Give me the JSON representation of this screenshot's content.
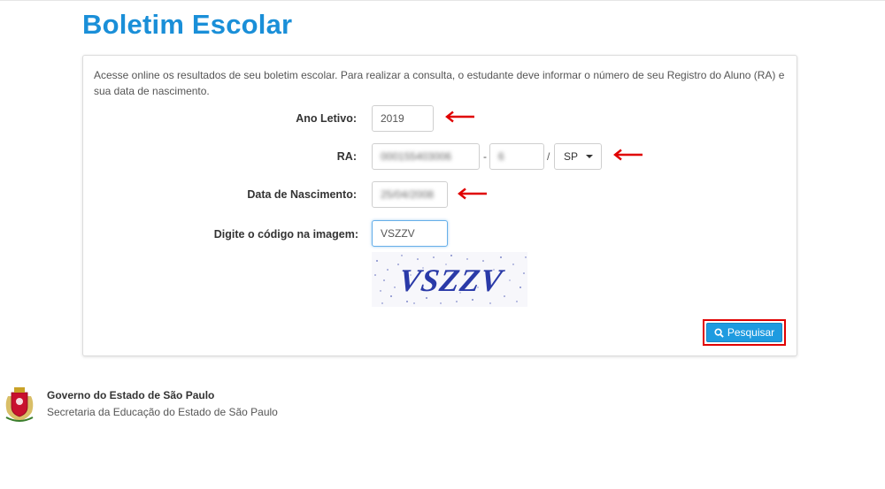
{
  "page": {
    "title": "Boletim Escolar",
    "intro": "Acesse online os resultados de seu boletim escolar. Para realizar a consulta, o estudante deve informar o número de seu Registro do Aluno (RA) e sua data de nascimento."
  },
  "form": {
    "ano_letivo": {
      "label": "Ano Letivo:",
      "value": "2019"
    },
    "ra": {
      "label": "RA:",
      "number_value": "000155403006",
      "separator_dash": "-",
      "digit_value": "6",
      "separator_slash": "/",
      "uf_value": "SP"
    },
    "data_nascimento": {
      "label": "Data de Nascimento:",
      "value": "25/04/2008"
    },
    "captcha": {
      "label": "Digite o código na imagem:",
      "value": "VSZZV",
      "image_text": "VSZZV"
    },
    "submit_label": "Pesquisar"
  },
  "footer": {
    "org_name": "Governo do Estado de São Paulo",
    "org_sub": "Secretaria da Educação do Estado de São Paulo"
  },
  "colors": {
    "title": "#1a8fd8",
    "button": "#1e9be0",
    "highlight": "#e00000",
    "captcha_text": "#2a3aa8"
  },
  "icons": [
    "search-icon",
    "red-arrow-icon",
    "sp-crest-icon"
  ]
}
